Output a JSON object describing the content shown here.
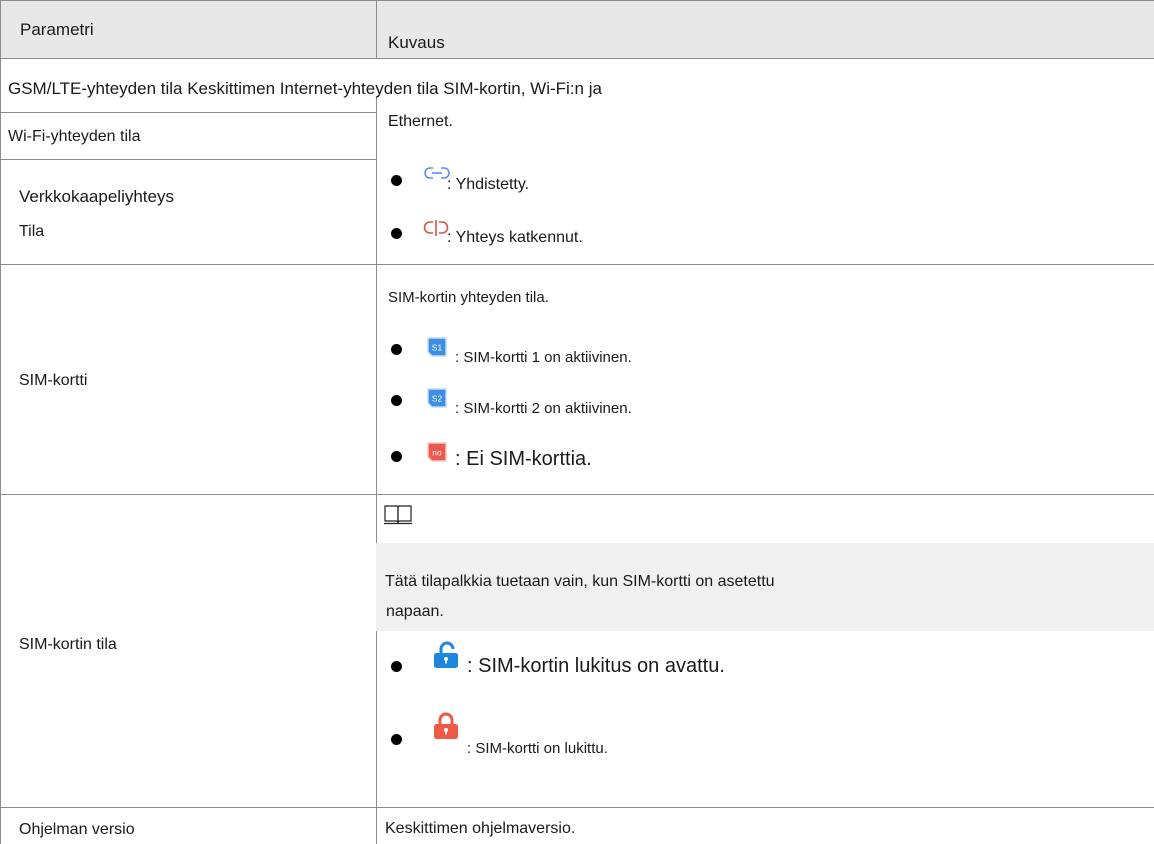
{
  "header": {
    "col1": "Parametri",
    "col2": "Kuvaus"
  },
  "rows": {
    "gsm_row": {
      "label_start": "GSM/LTE-yhteyden tila Keskittimen In",
      "label_cont": "ternet-yhteyden tila SIM-kortin, Wi-Fi:n ja",
      "cont_line2": "Ethernet.",
      "wifi_label": "Wi-Fi-yhteyden tila",
      "cable_label_1": "Verkkokaapeliyhteys",
      "cable_label_2": "Tila",
      "bullet_connected": ": Yhdistetty.",
      "bullet_disconnected": ": Yhteys katkennut.",
      "icons": [
        "link-connected-icon",
        "link-broken-icon"
      ]
    },
    "sim_row": {
      "label": "SIM-kortti",
      "intro": "SIM-kortin yhteyden tila.",
      "bullet_s1": ": SIM-kortti 1 on aktiivinen.",
      "bullet_s2": ": SIM-kortti 2 on aktiivinen.",
      "bullet_no": ": Ei SIM-korttia.",
      "icon_s1_text": "S1",
      "icon_s2_text": "S2",
      "icon_no_text": "no"
    },
    "sim_state_row": {
      "label": "SIM-kortin tila",
      "note_line1": "Tätä tilapalkkia tuetaan vain, kun SIM-kortti on asetettu",
      "note_line2": "napaan.",
      "bullet_unlocked": ": SIM-kortin lukitus on avattu.",
      "bullet_locked": ": SIM-kortti on lukittu.",
      "icons": [
        "note-book-icon",
        "unlocked-padlock-icon",
        "locked-padlock-icon"
      ]
    },
    "version_row": {
      "label": "Ohjelman versio",
      "desc": "Keskittimen ohjelmaversio."
    }
  },
  "colors": {
    "header_bg": "#e8e8e8",
    "note_bg": "#f0f0f0",
    "grid": "#8c8c8c",
    "sim_blue": "#3d8ee6",
    "sim_red": "#ec5a4e",
    "lock_blue": "#1f86e0",
    "lock_red": "#f05a45",
    "link_blue": "#5b8ef2",
    "link_red": "#e05050"
  }
}
